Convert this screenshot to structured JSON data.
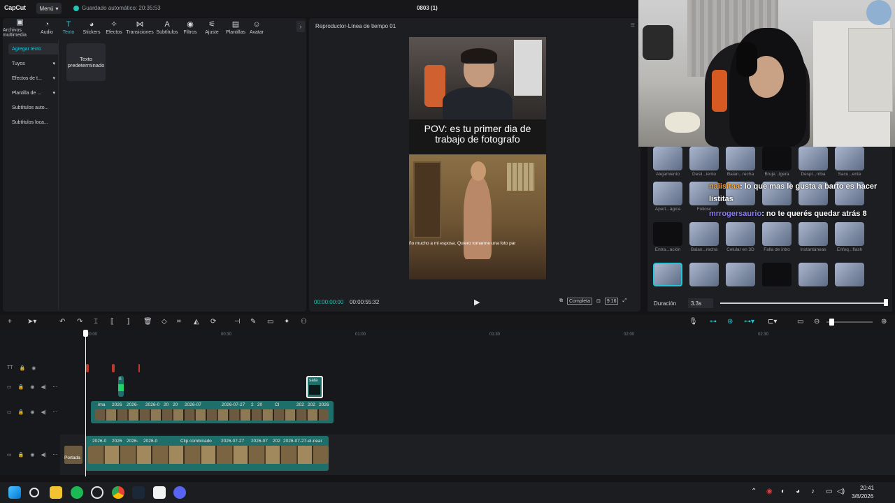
{
  "app": {
    "logo": "CapCut",
    "menu_label": "Menú",
    "autosave": "Guardado automático: 20:35:53",
    "project_title": "0803 (1)"
  },
  "toolbar": {
    "tabs": [
      {
        "label": "Archivos multimedia",
        "icon": "media-icon"
      },
      {
        "label": "Audio",
        "icon": "audio-icon"
      },
      {
        "label": "Texto",
        "icon": "text-icon",
        "active": true
      },
      {
        "label": "Stickers",
        "icon": "sticker-icon"
      },
      {
        "label": "Efectos",
        "icon": "effects-icon"
      },
      {
        "label": "Transiciones",
        "icon": "transition-icon"
      },
      {
        "label": "Subtítulos",
        "icon": "subtitles-icon"
      },
      {
        "label": "Filtros",
        "icon": "filter-icon"
      },
      {
        "label": "Ajuste",
        "icon": "adjust-icon"
      },
      {
        "label": "Plantillas",
        "icon": "templates-icon"
      },
      {
        "label": "Avatar",
        "icon": "avatar-icon"
      }
    ]
  },
  "text_sidebar": {
    "items": [
      {
        "label": "Agregar texto",
        "active": true
      },
      {
        "label": "Tuyos",
        "chevron": true
      },
      {
        "label": "Efectos de t...",
        "chevron": true
      },
      {
        "label": "Plantilla de ...",
        "chevron": true
      },
      {
        "label": "Subtítulos auto...",
        "chevron": false
      },
      {
        "label": "Subtítulos loca...",
        "chevron": false
      }
    ],
    "default_card": "Texto predeterminado"
  },
  "player": {
    "title": "Reproductor-Línea de tiempo 01",
    "caption": "POV: es tu primer dia de trabajo de fotografo",
    "subtitle_line": "ño mucho a mi esposa. Quiero tomarme una foto par",
    "time_current": "00:00:00:00",
    "time_total": "00:00:55:32",
    "btn_full": "Completa",
    "btn_ratio": "9:16"
  },
  "effects_panel": {
    "rows": [
      [
        "Alejamiento",
        "Desli...iento",
        "Balan...recha",
        "Bruje...lgera",
        "Despl...rriba",
        "Sacu...ente"
      ],
      [
        "Apert...ágica",
        "Foliosc",
        "",
        "",
        "",
        ""
      ],
      [
        "Entra...ación",
        "Balan...recha",
        "Celular en 3D",
        "Falla de intro",
        "Instantáneas",
        "Enfoq...flash"
      ],
      [
        "",
        "",
        "",
        "",
        "",
        ""
      ]
    ],
    "duration_label": "Duración",
    "duration_value": "3.3s",
    "duration_fraction": 1.0
  },
  "chat": [
    {
      "user": "naiisitaa",
      "message": ": lo que mas le gusta a barto es hacer listitas"
    },
    {
      "user": "mrrogersaurio",
      "message": ": no te querés quedar atrás 8"
    }
  ],
  "timeline": {
    "ticks": [
      "00:00",
      "00:30",
      "01:00",
      "01:30",
      "02:00",
      "02:30"
    ],
    "overlay_clip_label": "sata",
    "small_clip_label": "n",
    "video_clip_labels": [
      "ima",
      "2026",
      "2026-",
      "2026-0",
      "20",
      "20",
      "2026-07",
      "2026-07-27",
      "2",
      "20",
      "Cl",
      "202",
      "202",
      "2026"
    ],
    "main_clip_labels": [
      "2026-0",
      "2026",
      "2026-",
      "2026-0",
      "Clip combinado",
      "2026-07-27",
      "2026-07",
      "202",
      "2026-07-27-el-near"
    ],
    "cover_label": "Portada"
  },
  "taskbar": {
    "time": "20:41",
    "date": "3/8/2026"
  },
  "colors": {
    "accent": "#21c7d8",
    "clip_teal": "#1e6f6a",
    "background": "#141416"
  }
}
